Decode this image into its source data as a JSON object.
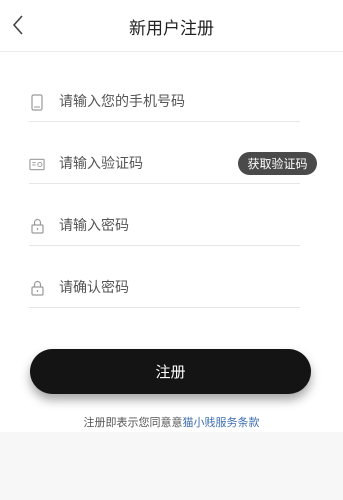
{
  "header": {
    "title": "新用户注册",
    "back_icon": "chevron-left-icon"
  },
  "form": {
    "phone": {
      "placeholder": "请输入您的手机号码",
      "icon": "phone-icon"
    },
    "code": {
      "placeholder": "请输入验证码",
      "icon": "sms-code-icon",
      "button_label": "获取验证码"
    },
    "password": {
      "placeholder": "请输入密码",
      "icon": "lock-icon"
    },
    "confirm": {
      "placeholder": "请确认密码",
      "icon": "lock-icon"
    }
  },
  "register_label": "注册",
  "terms": {
    "prefix": "注册即表示您同意意",
    "link": "猫小贱服务条款"
  },
  "colors": {
    "button": "#141414",
    "code_button": "#4a4a4a",
    "link": "#3f6fb0"
  }
}
